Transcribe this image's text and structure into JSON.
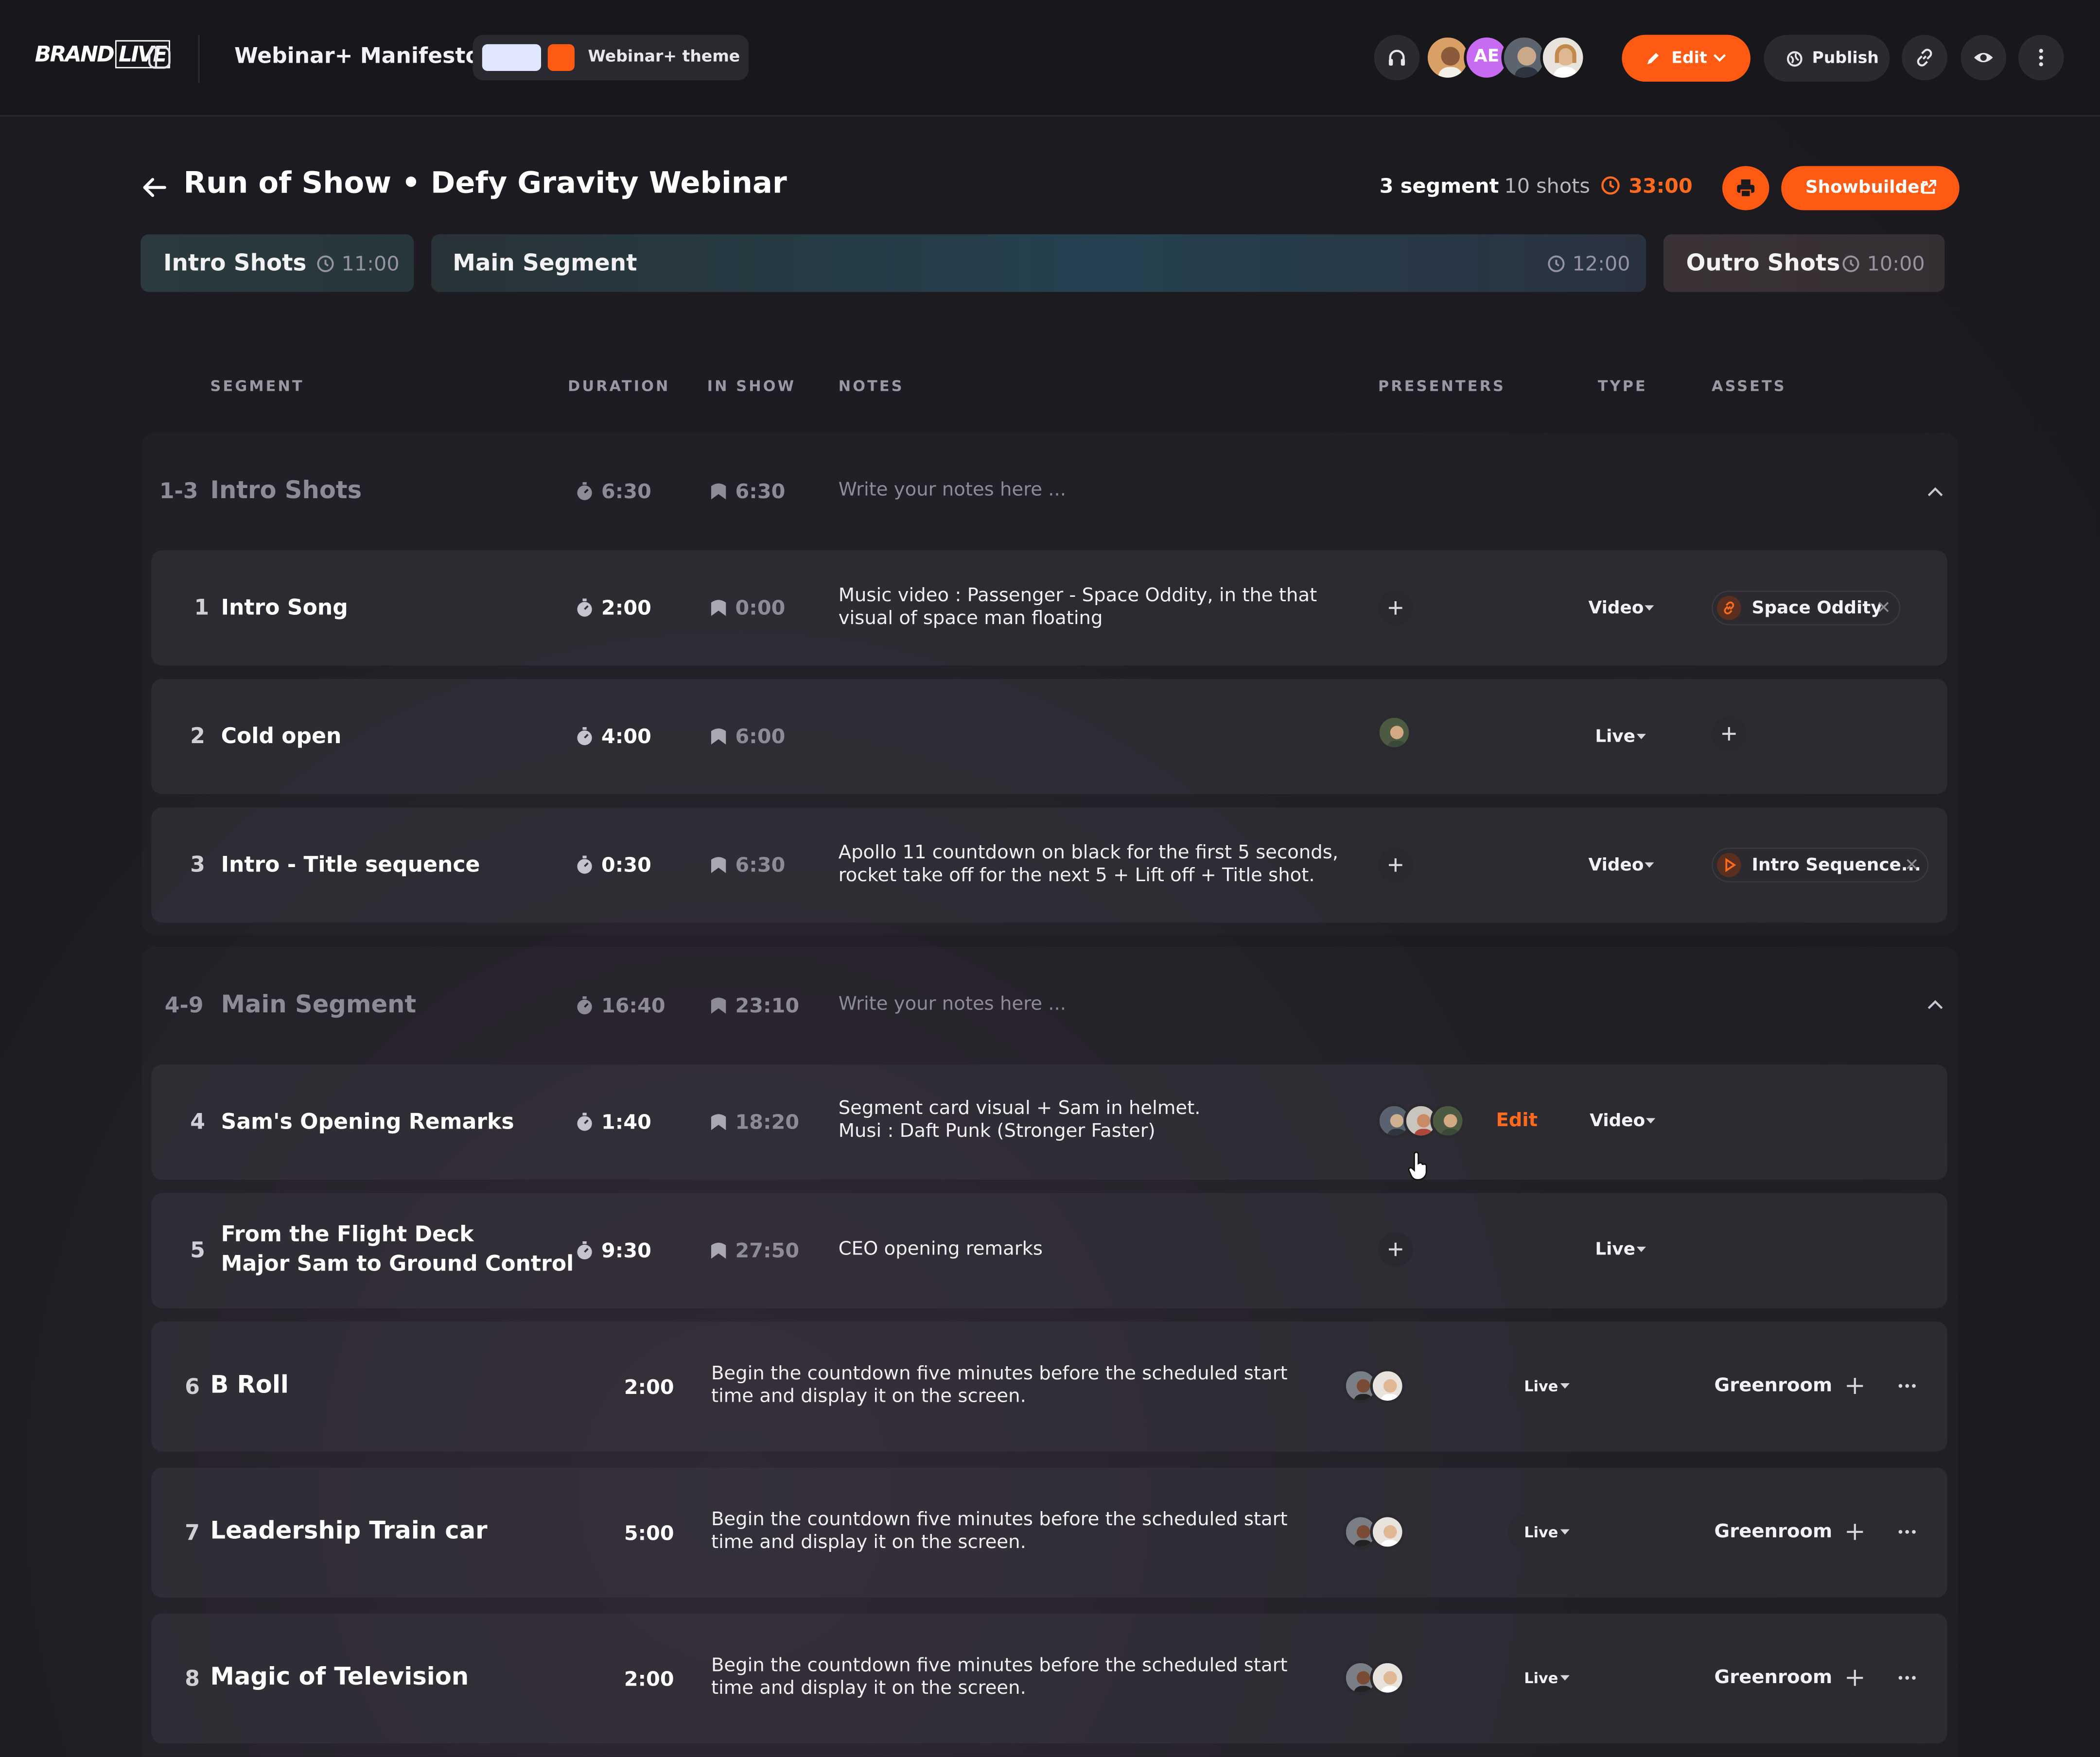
{
  "app": {
    "logo": {
      "brand": "BRAND",
      "live": "LIVE"
    },
    "document_title": "Webinar+ Manifesto",
    "theme": {
      "label": "Webinar+ theme",
      "swatch_light": "#dfe6ff",
      "swatch_accent": "#ff5a14"
    },
    "collaborators": {
      "initials": "AE"
    },
    "actions": {
      "edit": "Edit",
      "publish": "Publish"
    }
  },
  "colors": {
    "accent": "#ff5a14",
    "background": "#1b1a1f"
  },
  "header": {
    "title": "Run of Show • Defy Gravity Webinar",
    "segment_count": "3 segment",
    "shot_count": "10 shots",
    "total_time": "33:00",
    "showbuilder": "Showbuilder"
  },
  "segment_tabs": [
    {
      "name": "Intro Shots",
      "duration": "11:00"
    },
    {
      "name": "Main Segment",
      "duration": "12:00"
    },
    {
      "name": "Outro Shots",
      "duration": "10:00"
    }
  ],
  "columns": {
    "segment": "SEGMENT",
    "duration": "DURATION",
    "in_show": "IN SHOW",
    "notes": "NOTES",
    "presenters": "PRESENTERS",
    "type": "TYPE",
    "assets": "ASSETS"
  },
  "groups": [
    {
      "range": "1-3",
      "name": "Intro Shots",
      "duration": "6:30",
      "in_show": "6:30",
      "notes_placeholder": "Write your notes here ..."
    },
    {
      "range": "4-9",
      "name": "Main Segment",
      "duration": "16:40",
      "in_show": "23:10",
      "notes_placeholder": "Write your notes here ..."
    }
  ],
  "rows": [
    {
      "index": "1",
      "name": "Intro Song",
      "duration": "2:00",
      "in_show": "0:00",
      "notes": [
        "Music video : Passenger - Space Oddity,  in the that",
        "visual of space man floating"
      ],
      "type": "Video",
      "asset": "Space Oddity"
    },
    {
      "index": "2",
      "name": "Cold open",
      "duration": "4:00",
      "in_show": "6:00",
      "type": "Live"
    },
    {
      "index": "3",
      "name": "Intro - Title sequence",
      "duration": "0:30",
      "in_show": "6:30",
      "notes": [
        "Apollo 11 countdown on black for the first 5 seconds,",
        "rocket take off for the next 5 + Lift off + Title shot."
      ],
      "type": "Video",
      "asset": "Intro Sequence..."
    },
    {
      "index": "4",
      "name": "Sam's Opening Remarks",
      "duration": "1:40",
      "in_show": "18:20",
      "notes": [
        "Segment card visual  + Sam in helmet.",
        "Musi : Daft Punk (Stronger Faster)"
      ],
      "edit": "Edit",
      "type": "Video"
    },
    {
      "index": "5",
      "name": [
        "From the Flight Deck",
        "Major Sam to Ground Control"
      ],
      "duration": "9:30",
      "in_show": "27:50",
      "notes": [
        "CEO opening remarks"
      ],
      "type": "Live"
    },
    {
      "index": "6",
      "name": "B Roll",
      "duration": "2:00",
      "notes": [
        "Begin the countdown five minutes before the scheduled start",
        "time and display it on the screen."
      ],
      "type": "Live",
      "location": "Greenroom"
    },
    {
      "index": "7",
      "name": "Leadership Train car",
      "duration": "5:00",
      "notes": [
        "Begin the countdown five minutes before the scheduled start",
        "time and display it on the screen."
      ],
      "type": "Live",
      "location": "Greenroom"
    },
    {
      "index": "8",
      "name": "Magic of Television",
      "duration": "2:00",
      "notes": [
        "Begin the countdown five minutes before the scheduled start",
        "time and display it on the screen."
      ],
      "type": "Live",
      "location": "Greenroom"
    }
  ]
}
